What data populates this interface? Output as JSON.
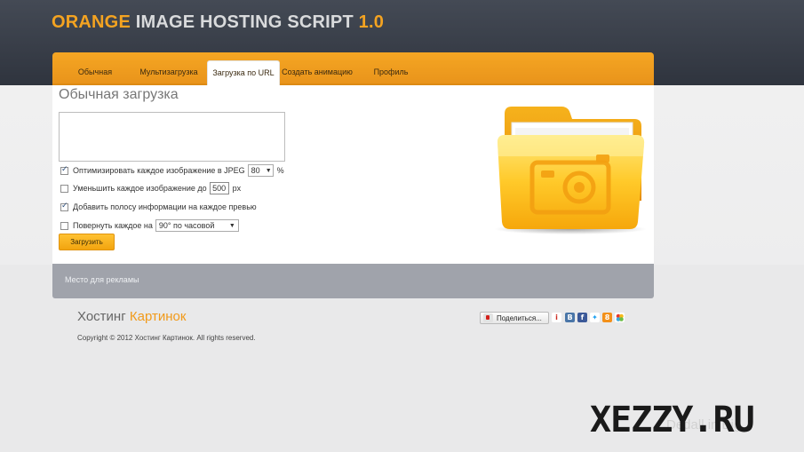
{
  "site": {
    "title_part1": "ORANGE",
    "title_part2": " IMAGE HOSTING SCRIPT ",
    "title_part3": "1.0"
  },
  "tabs": [
    {
      "label": "Обычная"
    },
    {
      "label": "Мультизагрузка"
    },
    {
      "label": "Загрузка по URL"
    },
    {
      "label": "Создать анимацию"
    },
    {
      "label": "Профиль"
    }
  ],
  "form": {
    "heading": "Обычная загрузка",
    "textarea_value": "",
    "option_optimize": {
      "label": "Оптимизировать каждое изображение в JPEG",
      "checked": true,
      "quality": "80",
      "unit": "%"
    },
    "option_resize": {
      "label": "Уменьшить каждое изображение до",
      "checked": false,
      "size": "500",
      "unit": "px"
    },
    "option_infobar": {
      "label": "Добавить полосу информации на каждое превью",
      "checked": true
    },
    "option_rotate": {
      "label": "Повернуть каждое на",
      "checked": false,
      "value": "90° по часовой"
    },
    "upload_label": "Загрузить"
  },
  "icons": {
    "folder": "folder-camera-icon",
    "share": "share-icon"
  },
  "colors": {
    "accent": "#f4a321",
    "header_bg": "#393f4b",
    "ad_bar": "#a0a3ab"
  },
  "ad": {
    "text": "Место для рекламы"
  },
  "footer": {
    "brand_part1": "Хостинг ",
    "brand_part2": "Картинок",
    "copyright": "Copyright © 2012 Хостинг Картинок. All rights reserved.",
    "share_label": "Поделиться..."
  },
  "watermark": {
    "text": "XEZZY.RU",
    "ghost": "Dedall in Big"
  }
}
